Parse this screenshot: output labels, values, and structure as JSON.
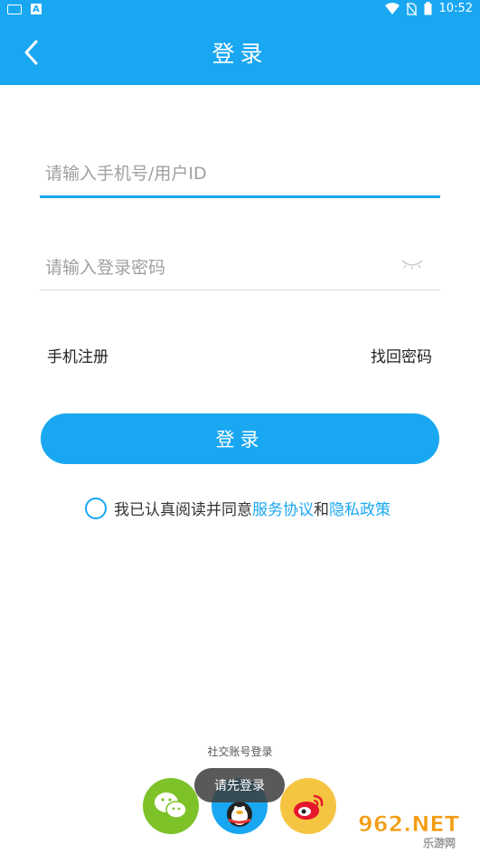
{
  "status_bar": {
    "time": "10:52",
    "left_badge": "A"
  },
  "header": {
    "title": "登录"
  },
  "form": {
    "username_placeholder": "请输入手机号/用户ID",
    "password_placeholder": "请输入登录密码"
  },
  "links": {
    "register": "手机注册",
    "forgot": "找回密码"
  },
  "login_button": "登录",
  "agreement": {
    "prefix": "我已认真阅读并同意",
    "service": "服务协议",
    "and": "和",
    "privacy": "隐私政策"
  },
  "social": {
    "title": "社交账号登录"
  },
  "toast": "请先登录",
  "watermark": {
    "main": "962.NET",
    "sub": "乐游网"
  },
  "colors": {
    "primary": "#1aa7f2",
    "wechat": "#7dc229",
    "weibo": "#f5c542"
  }
}
